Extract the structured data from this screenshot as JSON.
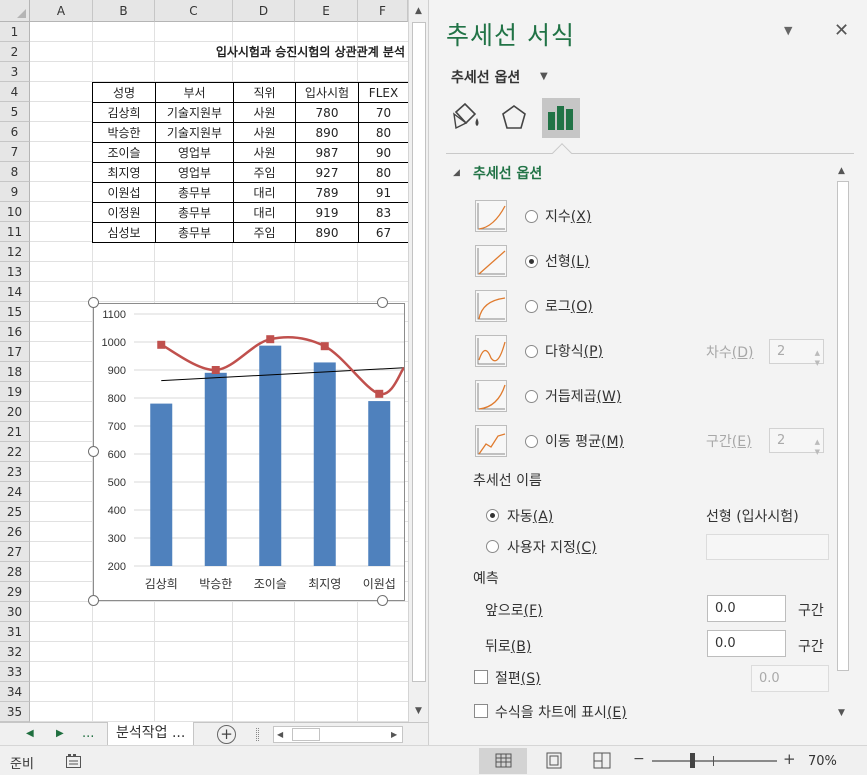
{
  "sheet": {
    "columns": [
      "A",
      "B",
      "C",
      "D",
      "E",
      "F"
    ],
    "rows": [
      "1",
      "2",
      "3",
      "4",
      "5",
      "6",
      "7",
      "8",
      "9",
      "10",
      "11",
      "12",
      "13",
      "14",
      "15",
      "16",
      "17",
      "18",
      "19",
      "20",
      "21",
      "22",
      "23",
      "24",
      "25",
      "26",
      "27",
      "28",
      "29",
      "30",
      "31",
      "32",
      "33",
      "34",
      "35"
    ],
    "title": "입사시험과 승진시험의 상관관계 분석",
    "table": {
      "headers": [
        "성명",
        "부서",
        "직위",
        "입사시험",
        "FLEX"
      ],
      "rows": [
        [
          "김상희",
          "기술지원부",
          "사원",
          "780",
          "70"
        ],
        [
          "박승한",
          "기술지원부",
          "사원",
          "890",
          "80"
        ],
        [
          "조이슬",
          "영업부",
          "사원",
          "987",
          "90"
        ],
        [
          "최지영",
          "영업부",
          "주임",
          "927",
          "80"
        ],
        [
          "이원섭",
          "총무부",
          "대리",
          "789",
          "91"
        ],
        [
          "이정원",
          "총무부",
          "대리",
          "919",
          "83"
        ],
        [
          "심성보",
          "총무부",
          "주임",
          "890",
          "67"
        ]
      ]
    },
    "sheet_tab": "분석작업 ...",
    "tab_nav": {
      "prev": "◀",
      "next": "▶",
      "more": "...",
      "add": "+"
    }
  },
  "chart_data": {
    "type": "bar",
    "categories": [
      "김상희",
      "박승한",
      "조이슬",
      "최지영",
      "이원섭"
    ],
    "series": [
      {
        "values": [
          780,
          890,
          987,
          927,
          789
        ],
        "color": "#4f81bd",
        "kind": "bar"
      },
      {
        "values": [
          990,
          900,
          1010,
          985,
          815
        ],
        "color": "#c0504d",
        "kind": "smooth-line-markers"
      }
    ],
    "trendline": {
      "kind": "linear",
      "start": 862,
      "end": 908,
      "color": "#000000"
    },
    "ylim": [
      200,
      1100
    ],
    "yticks": [
      "1100",
      "1000",
      "900",
      "800",
      "700",
      "600",
      "500",
      "400",
      "300",
      "200"
    ],
    "grid": true,
    "legend": "none"
  },
  "pane": {
    "title": "추세선 서식",
    "dropdown_icon": "chevron-down-icon",
    "close": "✕",
    "subtitle": "추세선 옵션",
    "section": "추세선 옵션",
    "options": [
      {
        "label": "지수",
        "key": "(X)",
        "selected": false
      },
      {
        "label": "선형",
        "key": "(L)",
        "selected": true
      },
      {
        "label": "로그",
        "key": "(O)",
        "selected": false
      },
      {
        "label": "다항식",
        "key": "(P)",
        "selected": false
      },
      {
        "label": "거듭제곱",
        "key": "(W)",
        "selected": false
      },
      {
        "label": "이동 평균",
        "key": "(M)",
        "selected": false
      }
    ],
    "order": {
      "label": "차수",
      "key": "(D)",
      "value": "2"
    },
    "period": {
      "label": "구간",
      "key": "(E)",
      "value": "2"
    },
    "name_header": "추세선 이름",
    "name_auto": {
      "label": "자동",
      "key": "(A)",
      "value": "선형 (입사시험)"
    },
    "name_custom": {
      "label": "사용자 지정",
      "key": "(C)"
    },
    "forecast_header": "예측",
    "forward": {
      "label": "앞으로",
      "key": "(F)",
      "value": "0.0",
      "unit": "구간"
    },
    "backward": {
      "label": "뒤로",
      "key": "(B)",
      "value": "0.0",
      "unit": "구간"
    },
    "intercept": {
      "label": "절편",
      "key": "(S)",
      "value": "0.0"
    },
    "equation": {
      "label": "수식을 차트에 표시",
      "key": "(E)"
    }
  },
  "status": {
    "ready": "준비",
    "zoom_minus": "−",
    "zoom_plus": "+",
    "zoom": "70%",
    "zoom_value": 0.7
  }
}
